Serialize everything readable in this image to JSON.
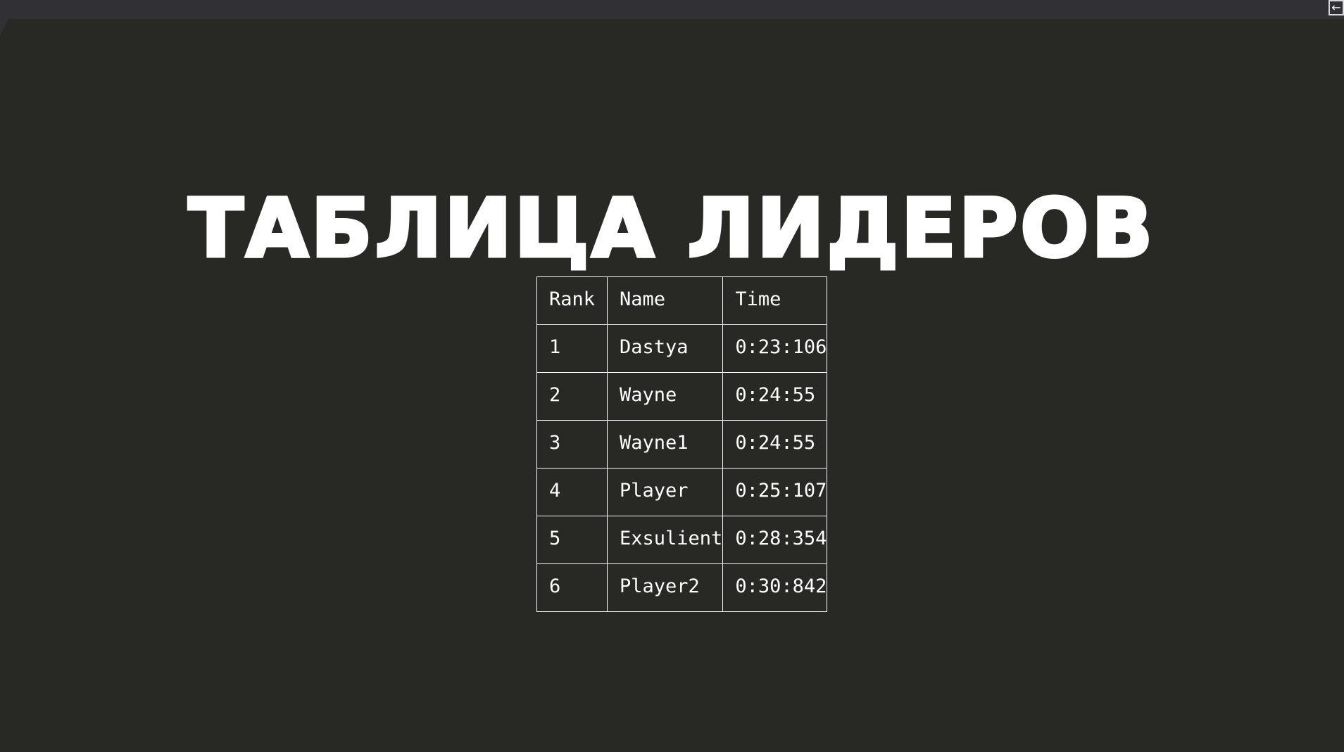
{
  "topbar": {
    "back_icon": "←"
  },
  "title": "ТАБЛИЦА ЛИДЕРОВ",
  "leaderboard": {
    "headers": [
      "Rank",
      "Name",
      "Time"
    ],
    "rows": [
      [
        "1",
        "Dastya",
        "0:23:106"
      ],
      [
        "2",
        "Wayne",
        "0:24:55"
      ],
      [
        "3",
        "Wayne1",
        "0:24:55"
      ],
      [
        "4",
        "Player",
        "0:25:107"
      ],
      [
        "5",
        "Exsulient",
        "0:28:354"
      ],
      [
        "6",
        "Player2",
        "0:30:842"
      ]
    ]
  },
  "colors": {
    "background": "#282825",
    "topbar": "#303035",
    "text": "#ffffff"
  }
}
